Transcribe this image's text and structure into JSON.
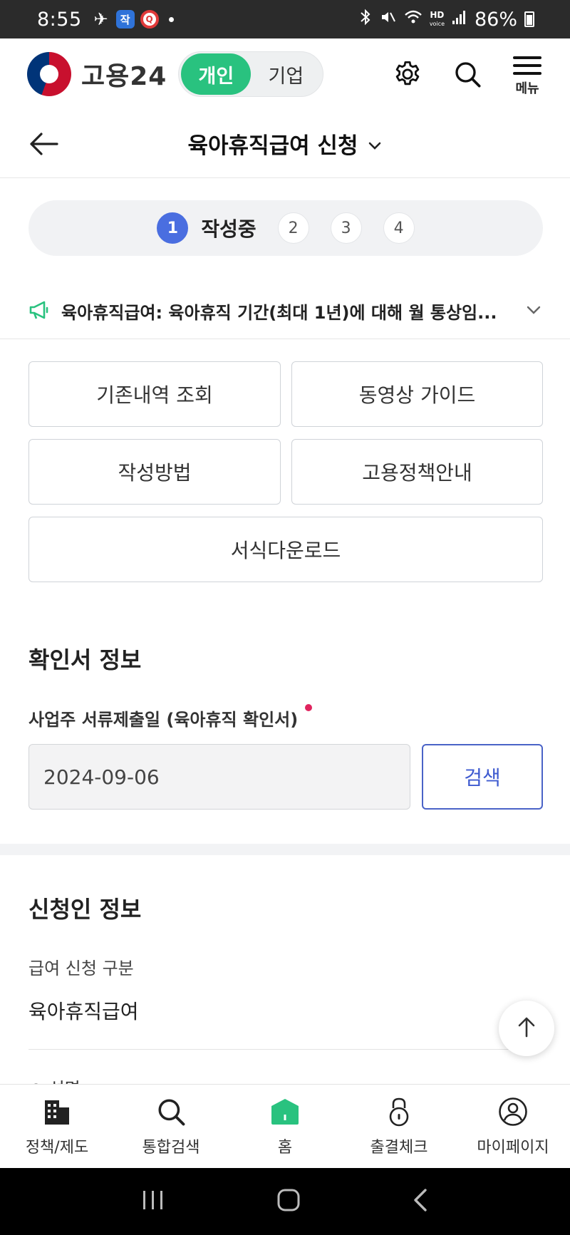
{
  "status_bar": {
    "time": "8:55",
    "app_badge_1": "작",
    "app_badge_2": "Q",
    "battery": "86%",
    "hd_top": "HD",
    "hd_bottom": "voice"
  },
  "header": {
    "logo_text": "고용24",
    "toggle": [
      "개인",
      "기업"
    ],
    "menu_label": "메뉴"
  },
  "page": {
    "title": "육아휴직급여 신청"
  },
  "stepper": {
    "active_num": "1",
    "active_label": "작성중",
    "steps": [
      "2",
      "3",
      "4"
    ]
  },
  "notice": {
    "text": "육아휴직급여: 육아휴직 기간(최대 1년)에 대해 월 통상임..."
  },
  "actions": [
    "기존내역 조회",
    "동영상 가이드",
    "작성방법",
    "고용정책안내",
    "서식다운로드"
  ],
  "confirm_section": {
    "title": "확인서 정보",
    "field_label": "사업주 서류제출일 (육아휴직 확인서)",
    "date_value": "2024-09-06",
    "search_label": "검색"
  },
  "applicant_section": {
    "title": "신청인 정보",
    "type_label": "급여 신청 구분",
    "type_value": "육아휴직급여",
    "next_label": "○ 성명"
  },
  "bottom_nav": [
    "정책/제도",
    "통합검색",
    "홈",
    "출결체크",
    "마이페이지"
  ],
  "colors": {
    "accent_green": "#29c27f",
    "step_blue": "#4a6ee0",
    "search_blue": "#3f5bd0",
    "required_red": "#e0245e"
  }
}
